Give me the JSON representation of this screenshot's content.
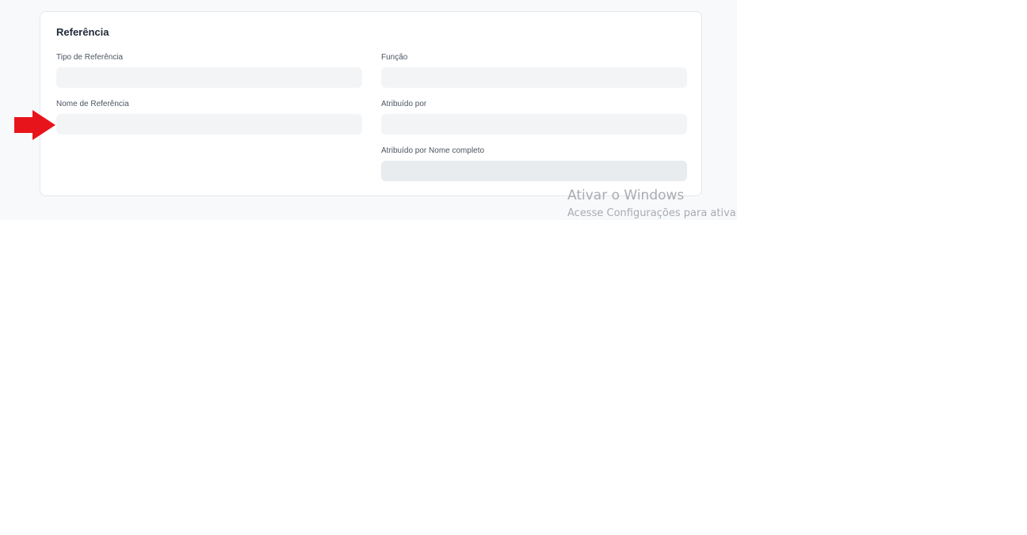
{
  "section": {
    "title": "Referência"
  },
  "fields": {
    "tipo_referencia": {
      "label": "Tipo de Referência",
      "value": ""
    },
    "funcao": {
      "label": "Função",
      "value": ""
    },
    "nome_referencia": {
      "label": "Nome de Referência",
      "value": ""
    },
    "atribuido_por": {
      "label": "Atribuído por",
      "value": ""
    },
    "atribuido_por_nome": {
      "label": "Atribuído por Nome completo",
      "value": ""
    }
  },
  "annotation": {
    "icon": "red-arrow-right-icon",
    "color": "#e8141b"
  },
  "watermark": {
    "title": "Ativar o Windows",
    "subtitle": "Acesse Configurações para ativar o Windows."
  },
  "colors": {
    "page_background": "#f8f9fa",
    "card_background": "#ffffff",
    "input_background": "#f3f4f6",
    "readonly_input_background": "#e9ecef"
  }
}
